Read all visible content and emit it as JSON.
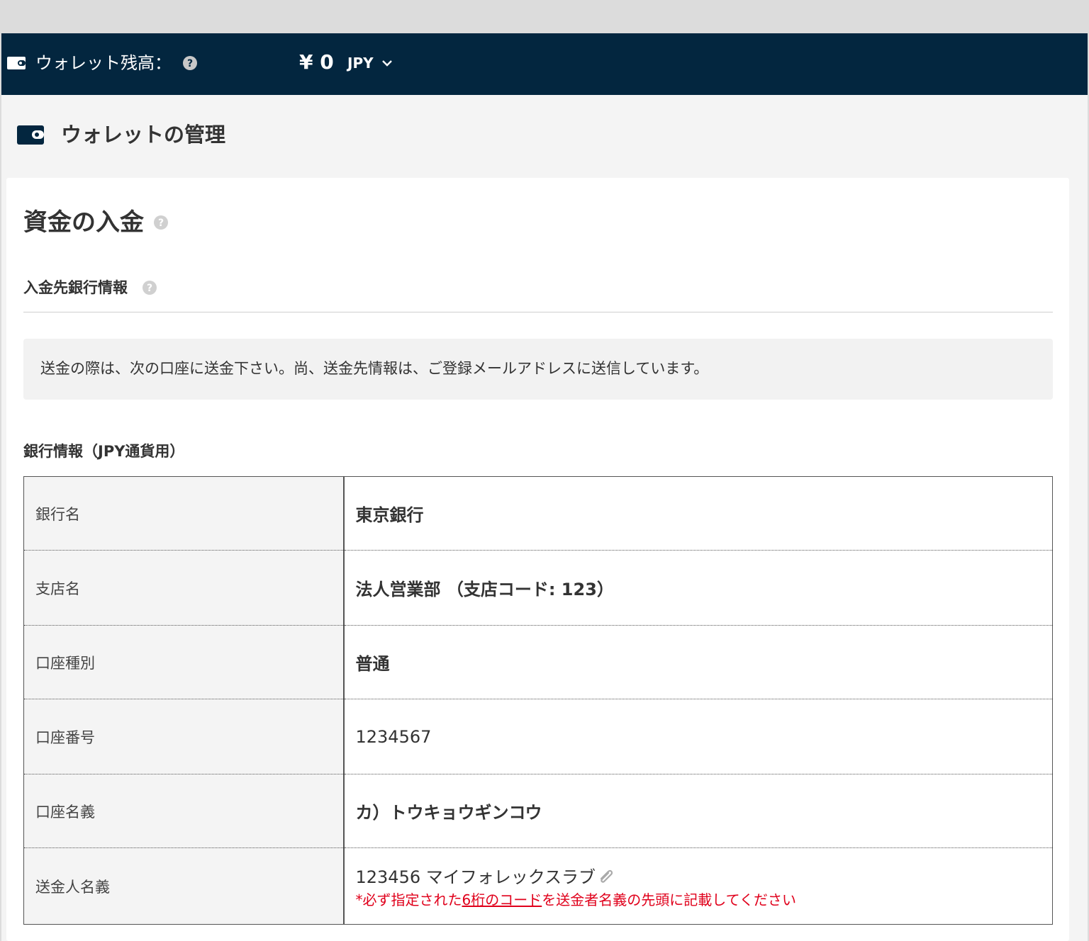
{
  "header": {
    "wallet_label": "ウォレット残高：",
    "balance": "¥ 0",
    "currency": "JPY"
  },
  "page": {
    "title": "ウォレットの管理"
  },
  "deposit": {
    "title": "資金の入金",
    "bank_info_heading": "入金先銀行情報",
    "notice": "送金の際は、次の口座に送金下さい。尚、送金先情報は、ご登録メールアドレスに送信しています。",
    "bank_table_heading": "銀行情報（JPY通貨用）",
    "rows": [
      {
        "label": "銀行名",
        "value": "東京銀行"
      },
      {
        "label": "支店名",
        "value": "法人営業部 （支店コード: 123）"
      },
      {
        "label": "口座種別",
        "value": "普通"
      },
      {
        "label": "口座番号",
        "value": "1234567"
      },
      {
        "label": "口座名義",
        "value": "カ）トウキョウギンコウ"
      },
      {
        "label": "送金人名義",
        "value": "123456 マイフォレックスラブ"
      }
    ],
    "remitter_note": {
      "prefix": "*必ず指定された",
      "underlined": "6桁のコード",
      "suffix": "を送金者名義の先頭に記載してください"
    }
  },
  "colors": {
    "topbar_bg": "#03263f",
    "warning_red": "#e0001b"
  },
  "icons": [
    "wallet-icon",
    "help-icon",
    "chevron-down-icon",
    "paperclip-icon"
  ]
}
